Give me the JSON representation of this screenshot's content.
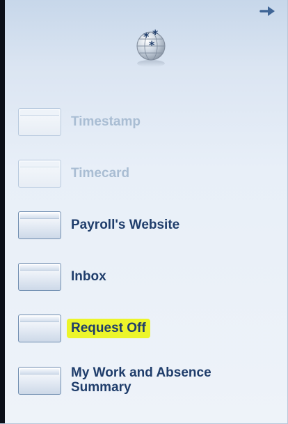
{
  "panel": {
    "collapse_icon": "arrow-right-icon",
    "logo_icon": "globe-stars-icon"
  },
  "nav": {
    "items": [
      {
        "label": "Timestamp",
        "enabled": false,
        "highlighted": false
      },
      {
        "label": "Timecard",
        "enabled": false,
        "highlighted": false
      },
      {
        "label": "Payroll's Website",
        "enabled": true,
        "highlighted": false
      },
      {
        "label": "Inbox",
        "enabled": true,
        "highlighted": false
      },
      {
        "label": "Request Off",
        "enabled": true,
        "highlighted": true
      },
      {
        "label": "My Work and Absence Summary",
        "enabled": true,
        "highlighted": false
      }
    ]
  },
  "colors": {
    "label": "#1f3d6b",
    "label_disabled": "#a9bdd3",
    "highlight": "#ecf52a",
    "arrow": "#3f6596"
  }
}
